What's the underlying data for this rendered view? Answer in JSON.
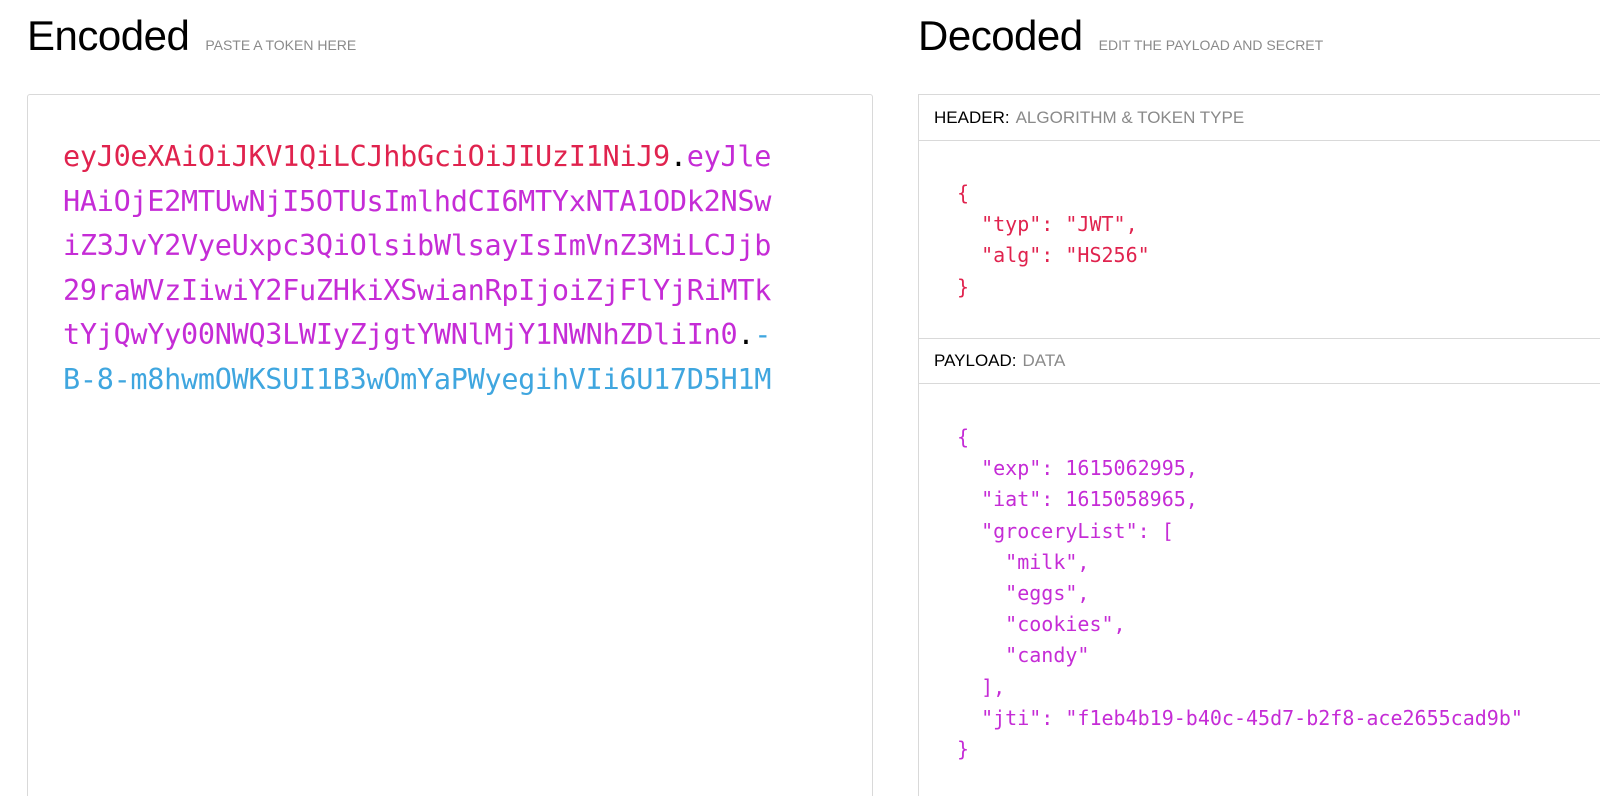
{
  "encoded": {
    "title": "Encoded",
    "subtitle": "PASTE A TOKEN HERE",
    "token": {
      "header": "eyJ0eXAiOiJKV1QiLCJhbGciOiJIUzI1NiJ9",
      "dot1": ".",
      "payload": "eyJleHAiOjE2MTUwNjI5OTUsImlhdCI6MTYxNTA1ODk2NSwiZ3JvY2VyeUxpc3QiOlsibWlsayIsImVnZ3MiLCJjb29raWVzIiwiY2FuZHkiXSwianRpIjoiZjFlYjRiMTktYjQwYy00NWQ3LWIyZjgtYWNlMjY1NWNhZDliIn0",
      "dot2": ".",
      "signature": "-B-8-m8hwmOWKSUI1B3wOmYaPWyegihVIi6U17D5H1M"
    }
  },
  "decoded": {
    "title": "Decoded",
    "subtitle": "EDIT THE PAYLOAD AND SECRET",
    "header_section": {
      "label": "HEADER:",
      "desc": "ALGORITHM & TOKEN TYPE",
      "json": "{\n  \"typ\": \"JWT\",\n  \"alg\": \"HS256\"\n}"
    },
    "payload_section": {
      "label": "PAYLOAD:",
      "desc": "DATA",
      "json": "{\n  \"exp\": 1615062995,\n  \"iat\": 1615058965,\n  \"groceryList\": [\n    \"milk\",\n    \"eggs\",\n    \"cookies\",\n    \"candy\"\n  ],\n  \"jti\": \"f1eb4b19-b40c-45d7-b2f8-ace2655cad9b\"\n}"
    }
  },
  "colors": {
    "header": "#e0234e",
    "payload": "#c52cd6",
    "signature": "#3fa6df"
  }
}
